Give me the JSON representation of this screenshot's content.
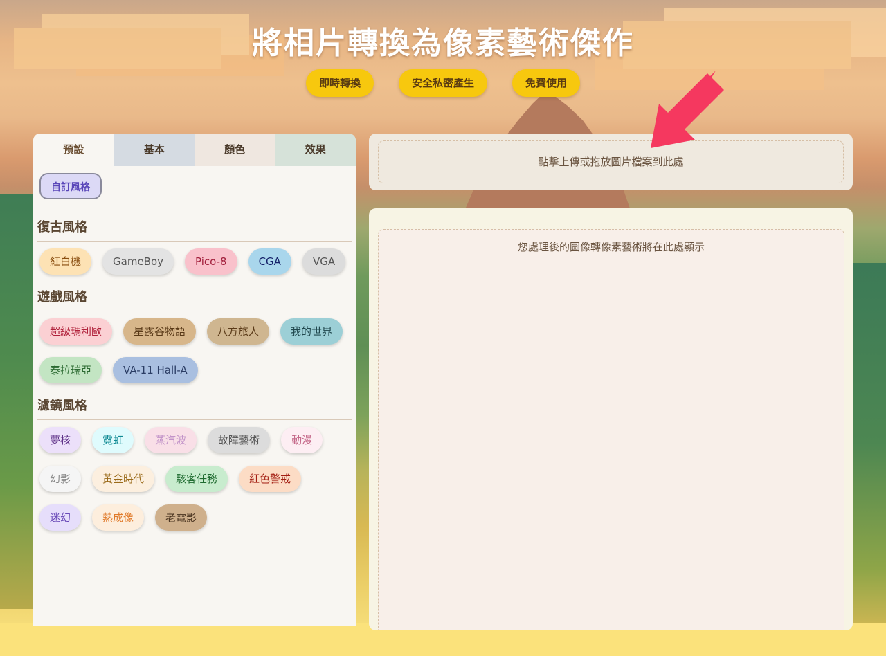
{
  "header": {
    "title": "將相片轉換為像素藝術傑作",
    "badges": [
      "即時轉換",
      "安全私密產生",
      "免費使用"
    ]
  },
  "tabs": [
    "預設",
    "基本",
    "顏色",
    "效果"
  ],
  "custom_style_button": "自訂風格",
  "sections": [
    {
      "title": "復古風格",
      "chips": [
        "紅白機",
        "GameBoy",
        "Pico-8",
        "CGA",
        "VGA"
      ]
    },
    {
      "title": "遊戲風格",
      "chips": [
        "超級瑪利歐",
        "星露谷物語",
        "八方旅人",
        "我的世界",
        "泰拉瑞亞",
        "VA-11 Hall-A"
      ]
    },
    {
      "title": "濾鏡風格",
      "chips": [
        "夢核",
        "霓虹",
        "蒸汽波",
        "故障藝術",
        "動漫",
        "幻影",
        "黃金時代",
        "駭客任務",
        "紅色警戒",
        "迷幻",
        "熱成像",
        "老電影"
      ]
    }
  ],
  "upload": {
    "prompt": "點擊上傳或拖放圖片檔案到此處"
  },
  "output": {
    "placeholder": "您處理後的圖像轉像素藝術將在此處顯示"
  },
  "colors": {
    "badge": "#f7c80e",
    "arrow": "#f5385f",
    "custom_button_bg": "#dcd9f6"
  }
}
